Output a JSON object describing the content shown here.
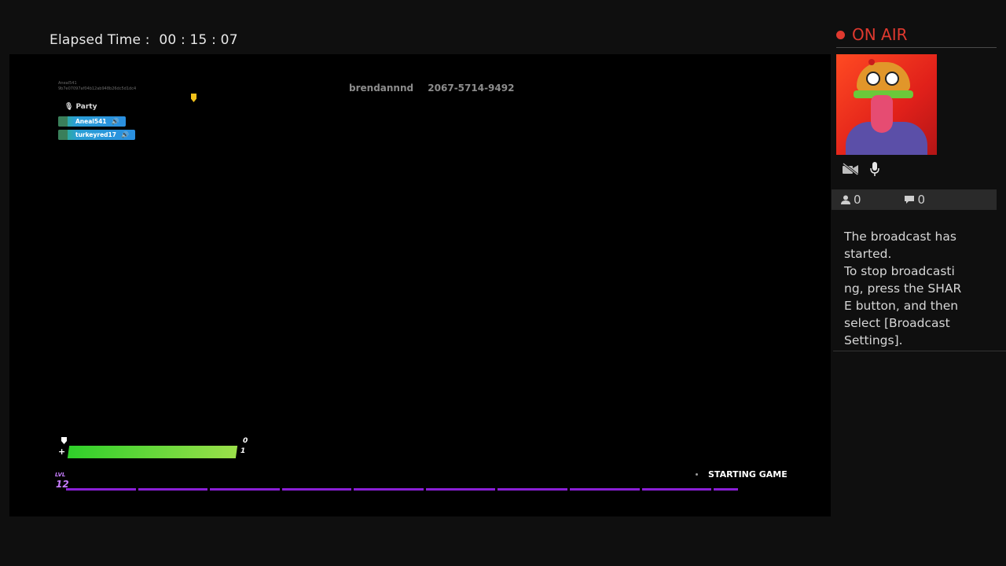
{
  "elapsed": {
    "label": "Elapsed Time",
    "value": "00 : 15 : 07"
  },
  "game": {
    "party": {
      "label": "Party",
      "owner_tiny": "Aneal541",
      "owner_id_tiny": "9b7e07097af04b12ab948b26dc5d1dc4",
      "members": [
        {
          "name": "Aneal541"
        },
        {
          "name": "turkeyred17"
        }
      ]
    },
    "player": {
      "name": "brendannnd",
      "code": "2067-5714-9492"
    },
    "hud": {
      "shield": "0",
      "health": "1",
      "health_fraction": 1.0,
      "level_label": "LVL",
      "level": "12",
      "xp_segments": 10,
      "status": "STARTING GAME"
    }
  },
  "broadcast": {
    "onair": "ON AIR",
    "viewers": "0",
    "comments": "0",
    "message": "The broadcast has\nstarted.\nTo stop broadcasti\nng, press the SHAR\nE button, and then\nselect [Broadcast\nSettings].",
    "colors": {
      "onair": "#e0392f",
      "health": "#2fd02a",
      "xp": "#8a1fd6"
    }
  }
}
